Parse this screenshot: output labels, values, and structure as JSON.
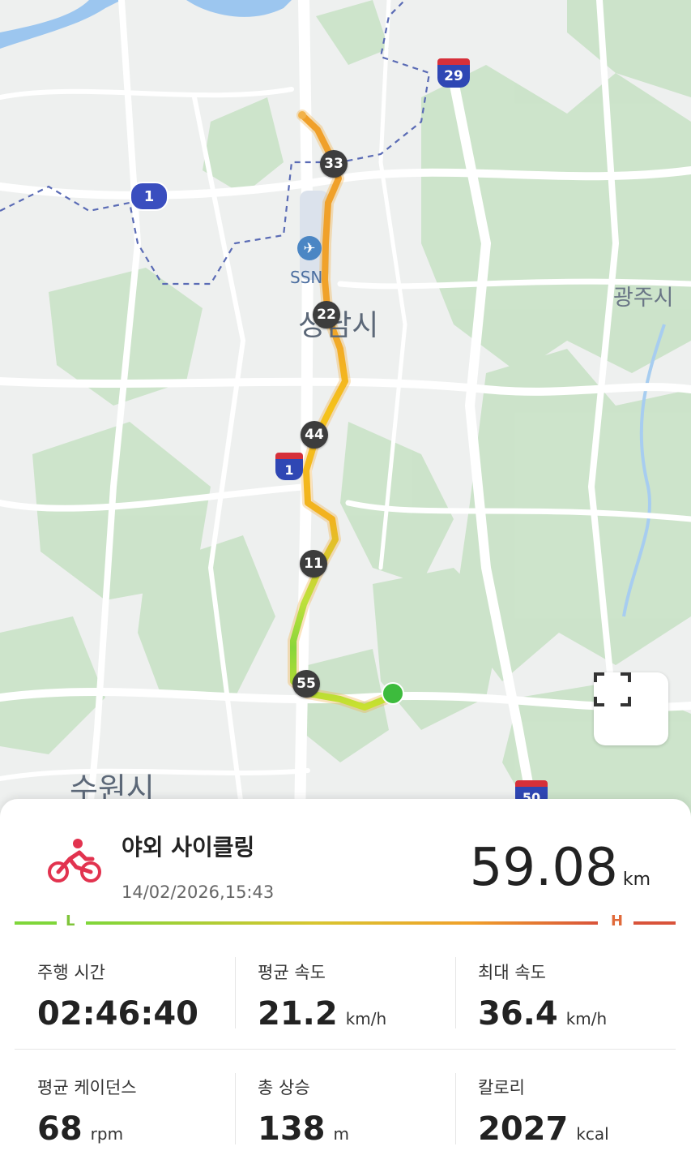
{
  "map": {
    "labels": {
      "airport": "SSN",
      "city_center": "성남시",
      "city_east": "광주시",
      "city_southwest": "수원시"
    },
    "shields": {
      "route_1_upper": "1",
      "route_1_lower": "1",
      "route_29": "29",
      "route_50": "50"
    },
    "km_markers": [
      "33",
      "22",
      "44",
      "11",
      "55"
    ],
    "colors": {
      "slow": "#7fd63a",
      "medium": "#f5c518",
      "fast": "#f09a2a",
      "start": "#3dbb3d"
    }
  },
  "activity": {
    "icon": "bicycle-icon",
    "title": "야외 사이클링",
    "date": "14/02/2026,15:43",
    "distance": "59.08",
    "distance_unit": "km"
  },
  "scale": {
    "low": "L",
    "high": "H"
  },
  "stats": [
    {
      "label": "주행 시간",
      "value": "02:46:40",
      "unit": ""
    },
    {
      "label": "평균 속도",
      "value": "21.2",
      "unit": "km/h"
    },
    {
      "label": "최대 속도",
      "value": "36.4",
      "unit": "km/h"
    },
    {
      "label": "평균 케이던스",
      "value": "68",
      "unit": "rpm"
    },
    {
      "label": "총 상승",
      "value": "138",
      "unit": "m"
    },
    {
      "label": "칼로리",
      "value": "2027",
      "unit": "kcal"
    }
  ]
}
